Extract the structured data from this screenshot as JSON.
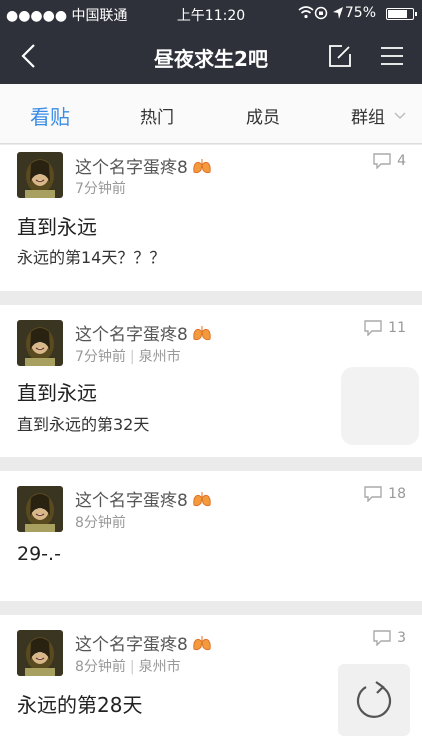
{
  "status_bar": {
    "carrier": "●●●●● 中国联通",
    "time": "上午11:20",
    "battery": "75%"
  },
  "nav": {
    "title": "昼夜求生2吧",
    "back_icon": "chevron-left-icon",
    "edit_icon": "compose-icon",
    "menu_icon": "hamburger-icon"
  },
  "tabs": [
    {
      "label": "看贴",
      "active": true
    },
    {
      "label": "热门"
    },
    {
      "label": "成员"
    },
    {
      "label": "群组"
    }
  ],
  "posts": [
    {
      "author": "这个名字蛋疼8",
      "time": "7分钟前",
      "location": "",
      "comments": "4",
      "title": "直到永远",
      "body": "永远的第14天？？？"
    },
    {
      "author": "这个名字蛋疼8",
      "time": "7分钟前",
      "location": "泉州市",
      "comments": "11",
      "title": "直到永远",
      "body": "直到永远的第32天"
    },
    {
      "author": "这个名字蛋疼8",
      "time": "8分钟前",
      "location": "",
      "comments": "18",
      "title": "29-.-",
      "body": ""
    },
    {
      "author": "这个名字蛋疼8",
      "time": "8分钟前",
      "location": "泉州市",
      "comments": "3",
      "title": "永远的第28天",
      "body": ""
    }
  ],
  "colors": {
    "nav_bg": "#2e313a",
    "active_tab": "#3b8ce6",
    "meta_text": "#999999"
  }
}
